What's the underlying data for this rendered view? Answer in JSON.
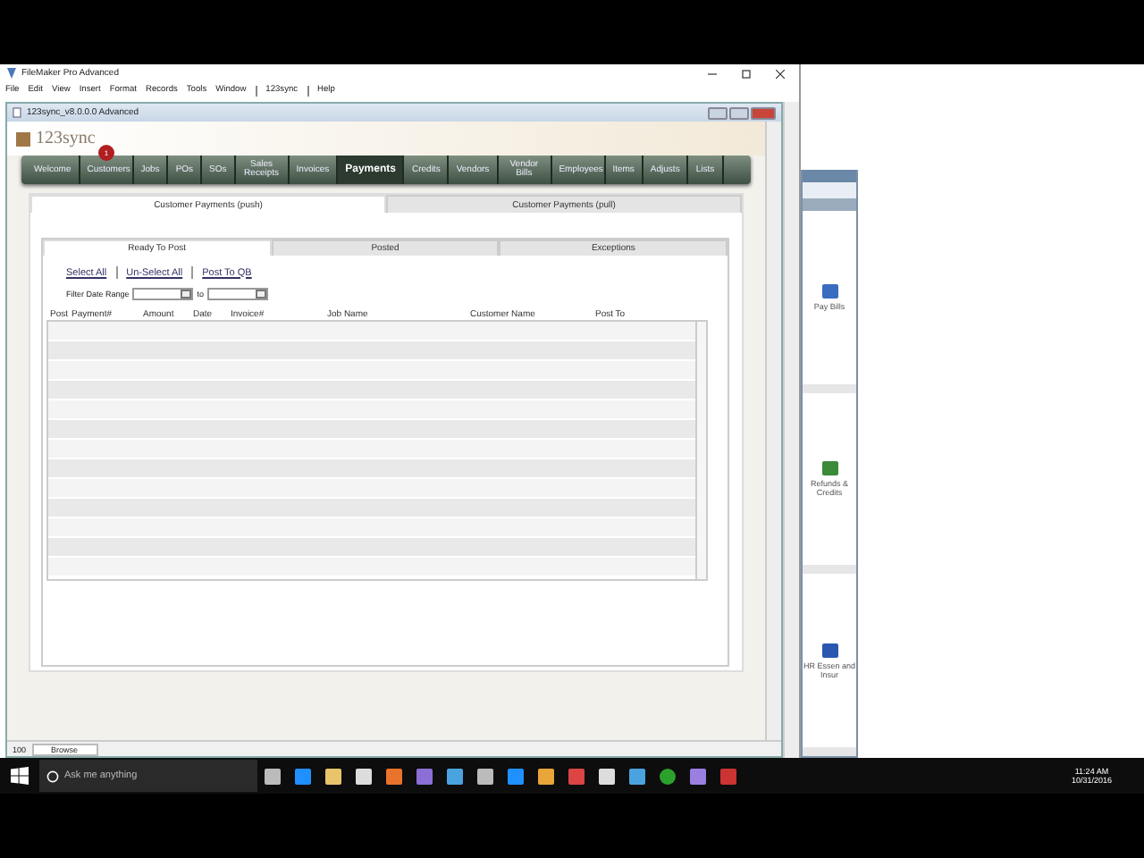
{
  "app": {
    "title": "FileMaker Pro Advanced",
    "menu": [
      "File",
      "Edit",
      "View",
      "Insert",
      "Format",
      "Records",
      "Tools",
      "Window",
      "123sync",
      "Help"
    ]
  },
  "document": {
    "title": "123sync_v8.0.0.0 Advanced",
    "logo": "123sync",
    "badge": "1"
  },
  "nav": [
    {
      "label": "Welcome",
      "selected": false
    },
    {
      "label": "Customers",
      "selected": false
    },
    {
      "label": "Jobs",
      "selected": false
    },
    {
      "label": "POs",
      "selected": false
    },
    {
      "label": "SOs",
      "selected": false
    },
    {
      "label": "Sales Receipts",
      "selected": false
    },
    {
      "label": "Invoices",
      "selected": false
    },
    {
      "label": "Payments",
      "selected": true
    },
    {
      "label": "Credits",
      "selected": false
    },
    {
      "label": "Vendors",
      "selected": false
    },
    {
      "label": "Vendor Bills",
      "selected": false
    },
    {
      "label": "Employees",
      "selected": false
    },
    {
      "label": "Items",
      "selected": false
    },
    {
      "label": "Adjusts",
      "selected": false
    },
    {
      "label": "Lists",
      "selected": false
    }
  ],
  "main_tabs": [
    {
      "label": "Customer Payments (push)",
      "selected": true
    },
    {
      "label": "Customer Payments (pull)",
      "selected": false
    }
  ],
  "sub_tabs": [
    {
      "label": "Ready To Post",
      "selected": true
    },
    {
      "label": "Posted",
      "selected": false
    },
    {
      "label": "Exceptions",
      "selected": false
    }
  ],
  "actions": [
    "Select All",
    "Un-Select All",
    "Post To QB"
  ],
  "filter": {
    "label": "Filter Date Range",
    "separator": "to"
  },
  "columns": [
    "Post",
    "Payment#",
    "Amount",
    "Date",
    "Invoice#",
    "Job Name",
    "Customer Name",
    "Post To"
  ],
  "status_bar": {
    "zoom": "100",
    "mode": "Browse"
  },
  "background_window": {
    "items": [
      {
        "label": "Pay Bills"
      },
      {
        "label": "Refunds & Credits"
      },
      {
        "label": "HR Essen and Insur"
      }
    ]
  },
  "taskbar": {
    "search_placeholder": "Ask me anything",
    "time": "11:24 AM",
    "date": "10/31/2016"
  }
}
